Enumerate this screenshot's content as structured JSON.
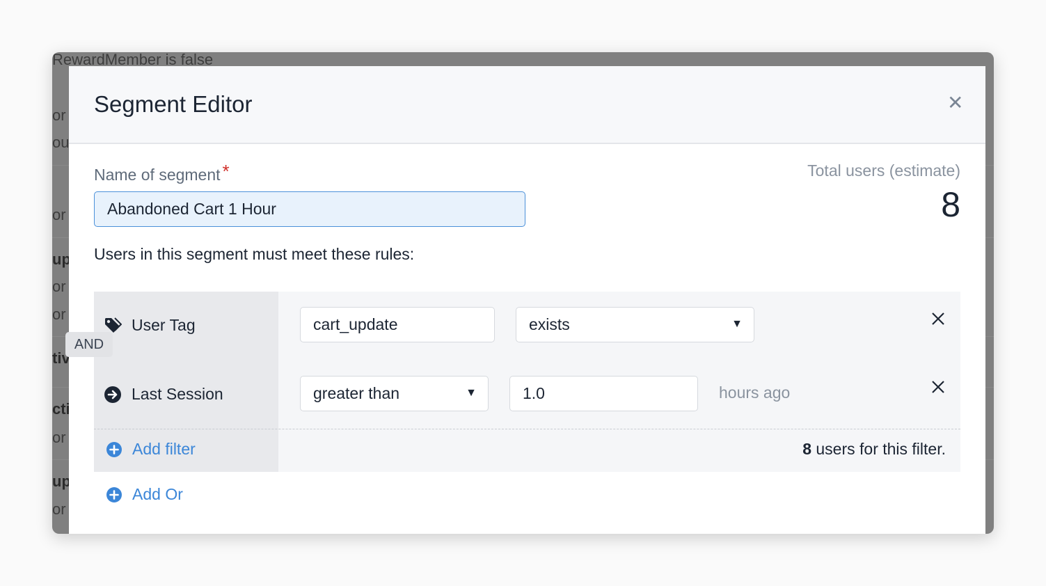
{
  "background": {
    "top_text": "RewardMember is false",
    "fragments": [
      "or",
      "ou",
      "or",
      "up",
      "or",
      "or",
      "tiv",
      "cti",
      "or",
      "up",
      "or"
    ]
  },
  "modal": {
    "title": "Segment Editor",
    "close_icon": "close-icon"
  },
  "segment": {
    "name_label": "Name of segment",
    "required_mark": "*",
    "name_value": "Abandoned Cart 1 Hour",
    "total_label": "Total users (estimate)",
    "total_value": "8",
    "rules_intro": "Users in this segment must meet these rules:"
  },
  "rules": {
    "and_label": "AND",
    "rows": [
      {
        "label": "User Tag",
        "icon": "tag-icon",
        "value": "cart_update",
        "operator": "exists"
      },
      {
        "label": "Last Session",
        "icon": "arrow-circle-right-icon",
        "operator": "greater than",
        "value": "1.0",
        "units": "hours ago"
      }
    ],
    "add_filter": "Add filter",
    "filter_count": "8",
    "filter_count_suffix": " users for this filter.",
    "add_or": "Add Or"
  },
  "colors": {
    "accent": "#3b86d8",
    "required": "#d0302a",
    "overlay": "#808080"
  }
}
